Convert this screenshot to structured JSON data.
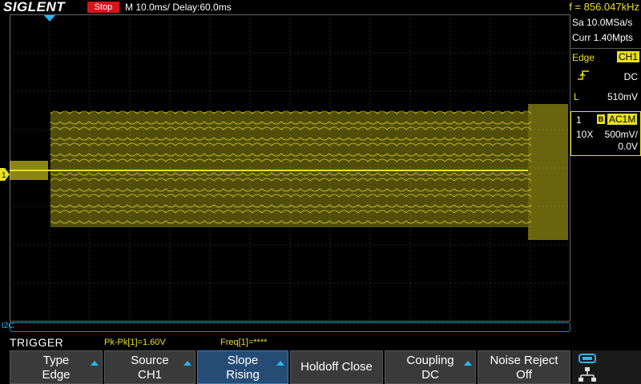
{
  "header": {
    "brand": "SIGLENT",
    "run_status": "Stop",
    "timebase": "M 10.0ms/ Delay:60.0ms",
    "frequency": "f = 856.047kHz"
  },
  "info": {
    "sample_rate": "Sa 10.0MSa/s",
    "memory": "Curr 1.40Mpts",
    "trigger_type": "Edge",
    "trigger_source": "CH1",
    "trigger_coupling": "DC",
    "level_label": "L",
    "level_value": "510mV"
  },
  "channel": {
    "number": "1",
    "bw_badge": "B",
    "coupling": "AC1M",
    "probe": "10X",
    "vdiv": "500mV/",
    "offset": "0.0V",
    "marker_label": "1"
  },
  "bottom": {
    "serial_label": "I2C",
    "menu_title": "TRIGGER",
    "meas_pkpk": "Pk-Pk[1]=1.60V",
    "meas_freq": "Freq[1]=****"
  },
  "softkeys": [
    {
      "line1": "Type",
      "line2": "Edge",
      "arrow": true,
      "selected": false
    },
    {
      "line1": "Source",
      "line2": "CH1",
      "arrow": true,
      "selected": false
    },
    {
      "line1": "Slope",
      "line2": "Rising",
      "arrow": true,
      "selected": true
    },
    {
      "single": "Holdoff Close",
      "arrow": false,
      "selected": false
    },
    {
      "line1": "Coupling",
      "line2": "DC",
      "arrow": true,
      "selected": false
    },
    {
      "line1": "Noise Reject",
      "line2": "Off",
      "arrow": false,
      "selected": false
    }
  ],
  "colors": {
    "trace": "#e8e020",
    "accent": "#2bb6f0",
    "stop": "#d8141b",
    "grid": "#4a4a4a"
  },
  "icons": {
    "slope": "rising-edge-icon",
    "trigger_marker": "trigger-position-icon",
    "network": "network-icon",
    "usb": "usb-icon"
  }
}
